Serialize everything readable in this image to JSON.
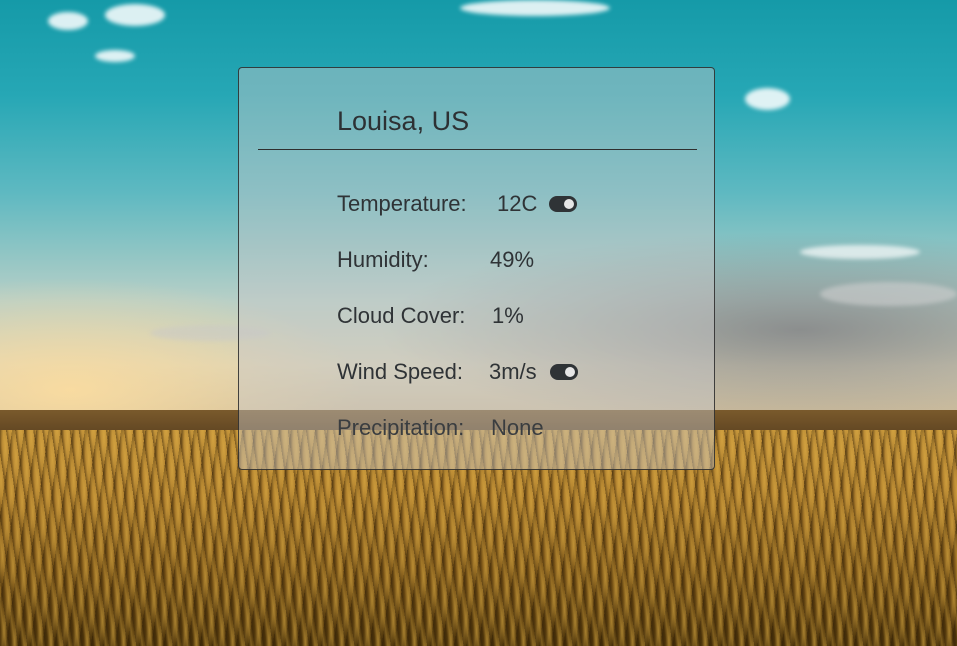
{
  "location": "Louisa, US",
  "weather": {
    "temperature": {
      "label": "Temperature:",
      "value": "12C",
      "toggle_on": true
    },
    "humidity": {
      "label": "Humidity:",
      "value": "49%"
    },
    "cloud_cover": {
      "label": "Cloud Cover:",
      "value": "1%"
    },
    "wind_speed": {
      "label": "Wind Speed:",
      "value": "3m/s",
      "toggle_on": true
    },
    "precipitation": {
      "label": "Precipitation:",
      "value": "None"
    }
  },
  "colors": {
    "text": "#2f3336",
    "card_border": "#2e2e2e",
    "toggle": "#2f3336"
  }
}
